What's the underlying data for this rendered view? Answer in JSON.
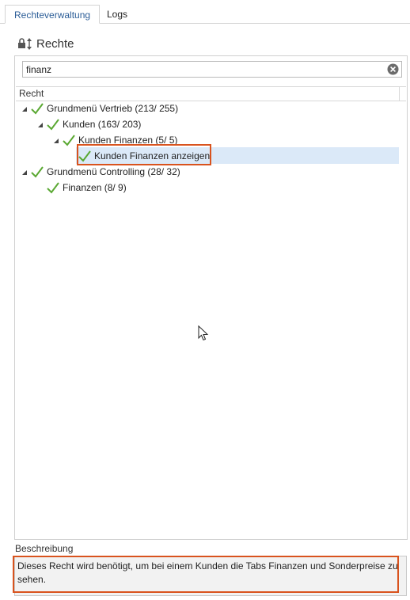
{
  "tabs": [
    {
      "label": "Rechteverwaltung",
      "active": true
    },
    {
      "label": "Logs",
      "active": false
    }
  ],
  "section": {
    "title": "Rechte",
    "icon": "lock-sort-icon"
  },
  "search": {
    "value": "finanz",
    "placeholder": ""
  },
  "grid": {
    "column_header": "Recht"
  },
  "tree": [
    {
      "label": "Grundmenü Vertrieb (213/ 255)",
      "level": 0,
      "expanded": true
    },
    {
      "label": "Kunden (163/ 203)",
      "level": 1,
      "expanded": true
    },
    {
      "label": "Kunden Finanzen (5/ 5)",
      "level": 2,
      "expanded": true
    },
    {
      "label": "Kunden Finanzen anzeigen",
      "level": 3,
      "selected": true
    },
    {
      "label": "Grundmenü Controlling (28/ 32)",
      "level": 0,
      "expanded": true
    },
    {
      "label": "Finanzen (8/ 9)",
      "level": 1
    }
  ],
  "description": {
    "label": "Beschreibung",
    "text": "Dieses Recht wird benötigt, um bei einem Kunden die Tabs Finanzen und Sonderpreise zu sehen."
  },
  "colors": {
    "accent": "#2b5d97",
    "check": "#5aa832",
    "highlight": "#d9531e",
    "selection": "#dbe9f8"
  }
}
